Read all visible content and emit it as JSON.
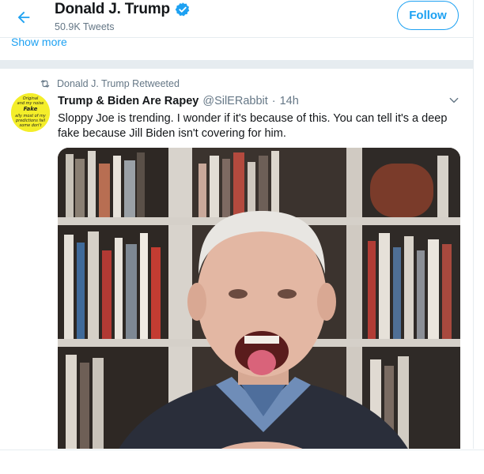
{
  "header": {
    "title": "Donald J. Trump",
    "tweet_count": "50.9K Tweets",
    "follow_label": "Follow",
    "back_icon": "arrow-left-icon",
    "verified_icon": "verified-badge-icon"
  },
  "profile": {
    "show_more_label": "Show more"
  },
  "tweet": {
    "retweet_label": "Donald J. Trump Retweeted",
    "retweet_icon": "retweet-icon",
    "author_name": "Trump & Biden Are Rapey",
    "author_handle": "@SilERabbit",
    "separator": "·",
    "time": "14h",
    "caret_icon": "chevron-down-icon",
    "text": "Sloppy Joe is trending. I wonder if it's because of this. You can tell it's a deep fake because Jill Biden isn't covering for him.",
    "avatar_text": [
      "Original",
      "and my noise",
      "Fake",
      "ally most of my",
      "predictions fail",
      "some don't"
    ]
  },
  "colors": {
    "accent": "#1da1f2",
    "text_primary": "#14171a",
    "text_secondary": "#657786",
    "divider": "#e6ecf0",
    "avatar_bg": "#f4ee2a"
  }
}
